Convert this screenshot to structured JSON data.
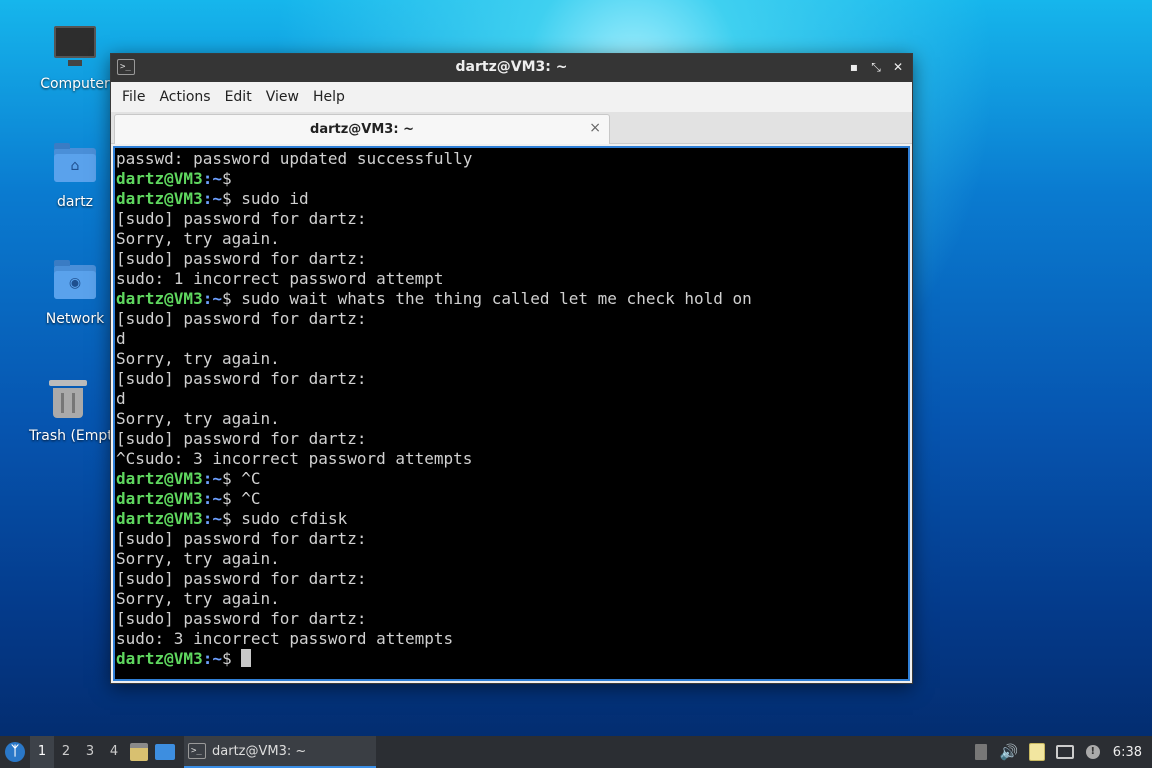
{
  "desktop": {
    "icons": [
      {
        "label": "Computer"
      },
      {
        "label": "dartz"
      },
      {
        "label": "Network"
      },
      {
        "label": "Trash (Empty)"
      }
    ]
  },
  "window": {
    "title": "dartz@VM3: ~",
    "menu": [
      "File",
      "Actions",
      "Edit",
      "View",
      "Help"
    ],
    "tab_label": "dartz@VM3: ~",
    "tab_close": "×",
    "buttons": {
      "minimize": "▪",
      "maximize": "⤡",
      "close": "✕"
    }
  },
  "terminal": {
    "user_host": "dartz@VM3",
    "path": ":~",
    "lines": [
      {
        "type": "out",
        "text": "passwd: password updated successfully"
      },
      {
        "type": "prompt",
        "cmd": ""
      },
      {
        "type": "prompt",
        "cmd": " sudo id"
      },
      {
        "type": "out",
        "text": "[sudo] password for dartz:"
      },
      {
        "type": "out",
        "text": "Sorry, try again."
      },
      {
        "type": "out",
        "text": "[sudo] password for dartz:"
      },
      {
        "type": "out",
        "text": "sudo: 1 incorrect password attempt"
      },
      {
        "type": "prompt",
        "cmd": " sudo wait whats the thing called let me check hold on"
      },
      {
        "type": "out",
        "text": "[sudo] password for dartz:"
      },
      {
        "type": "out",
        "text": "d"
      },
      {
        "type": "out",
        "text": "Sorry, try again."
      },
      {
        "type": "out",
        "text": "[sudo] password for dartz:"
      },
      {
        "type": "out",
        "text": "d"
      },
      {
        "type": "out",
        "text": "Sorry, try again."
      },
      {
        "type": "out",
        "text": "[sudo] password for dartz:"
      },
      {
        "type": "out",
        "text": "^Csudo: 3 incorrect password attempts"
      },
      {
        "type": "prompt",
        "cmd": " ^C"
      },
      {
        "type": "prompt",
        "cmd": " ^C"
      },
      {
        "type": "prompt",
        "cmd": " sudo cfdisk"
      },
      {
        "type": "out",
        "text": "[sudo] password for dartz:"
      },
      {
        "type": "out",
        "text": "Sorry, try again."
      },
      {
        "type": "out",
        "text": "[sudo] password for dartz:"
      },
      {
        "type": "out",
        "text": "Sorry, try again."
      },
      {
        "type": "out",
        "text": "[sudo] password for dartz:"
      },
      {
        "type": "out",
        "text": "sudo: 3 incorrect password attempts"
      },
      {
        "type": "prompt",
        "cmd": " ",
        "cursor": true
      }
    ]
  },
  "taskbar": {
    "workspaces": [
      "1",
      "2",
      "3",
      "4"
    ],
    "active_workspace": "1",
    "task_label": "dartz@VM3: ~",
    "clock": "6:38"
  }
}
